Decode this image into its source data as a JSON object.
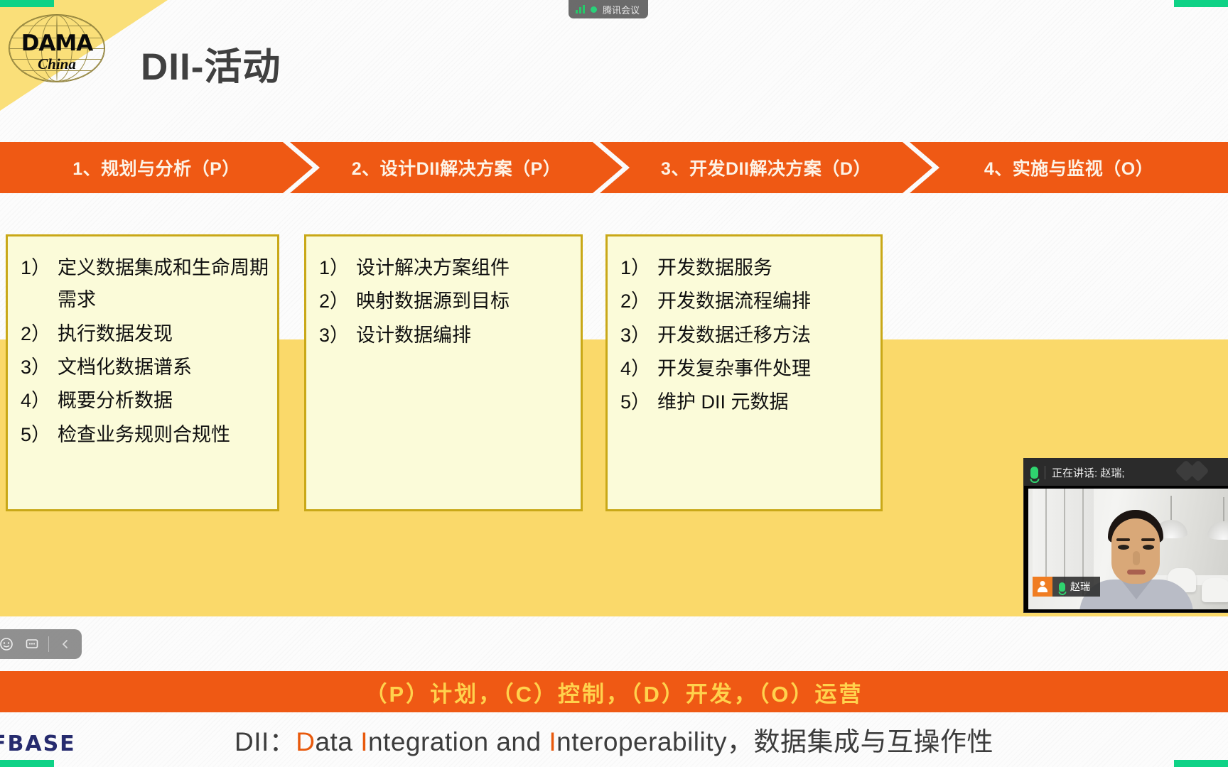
{
  "meeting": {
    "app_badge": "腾讯会议",
    "signal_icon": "signal-bars-icon",
    "status_dot_color": "#2ad17a",
    "accent_green": "#0fd286"
  },
  "toolbar": {
    "emoji_icon": "emoji-icon",
    "chat_icon": "chat-icon",
    "collapse_icon": "chevron-left-icon"
  },
  "slide": {
    "logo": {
      "brand": "DAMA",
      "region": "China"
    },
    "title": "DII-活动",
    "process_steps": [
      {
        "label": "1、规划与分析（P）"
      },
      {
        "label": "2、设计DII解决方案（P）"
      },
      {
        "label": "3、开发DII解决方案（D）"
      },
      {
        "label": "4、实施与监视（O）"
      }
    ],
    "boxes": [
      {
        "items": [
          {
            "num": "1）",
            "text": "定义数据集成和生命周期需求"
          },
          {
            "num": "2）",
            "text": "执行数据发现"
          },
          {
            "num": "3）",
            "text": "文档化数据谱系"
          },
          {
            "num": "4）",
            "text": "概要分析数据"
          },
          {
            "num": "5）",
            "text": "检查业务规则合规性"
          }
        ]
      },
      {
        "items": [
          {
            "num": "1）",
            "text": "设计解决方案组件"
          },
          {
            "num": "2）",
            "text": "映射数据源到目标"
          },
          {
            "num": "3）",
            "text": "设计数据编排"
          }
        ]
      },
      {
        "items": [
          {
            "num": "1）",
            "text": "开发数据服务"
          },
          {
            "num": "2）",
            "text": "开发数据流程编排"
          },
          {
            "num": "3）",
            "text": "开发数据迁移方法"
          },
          {
            "num": "4）",
            "text": "开发复杂事件处理"
          },
          {
            "num": "5）",
            "text": "维护 DII 元数据"
          }
        ]
      }
    ],
    "legend_bar": "（P）计划，（C）控制，（D）开发，（O）运营",
    "caption": {
      "prefix": "DII：",
      "d1": "D",
      "w1": "ata ",
      "i1": "I",
      "w2": "ntegration and ",
      "i2": "I",
      "w3": "nteroperability",
      "suffix": "，数据集成与互操作性"
    },
    "footer_logo": "FBASE",
    "colors": {
      "orange": "#ef5914",
      "gold": "#ffd24d",
      "box_fill": "#fbfbd9",
      "box_border": "#c9a818",
      "band_yellow": "#fad96a",
      "caption_highlight": "#e8590c"
    }
  },
  "video": {
    "speaking_label": "正在讲话: 赵瑞;",
    "participant_name": "赵瑞",
    "mic_icon": "microphone-icon",
    "avatar_icon": "person-avatar-icon"
  }
}
